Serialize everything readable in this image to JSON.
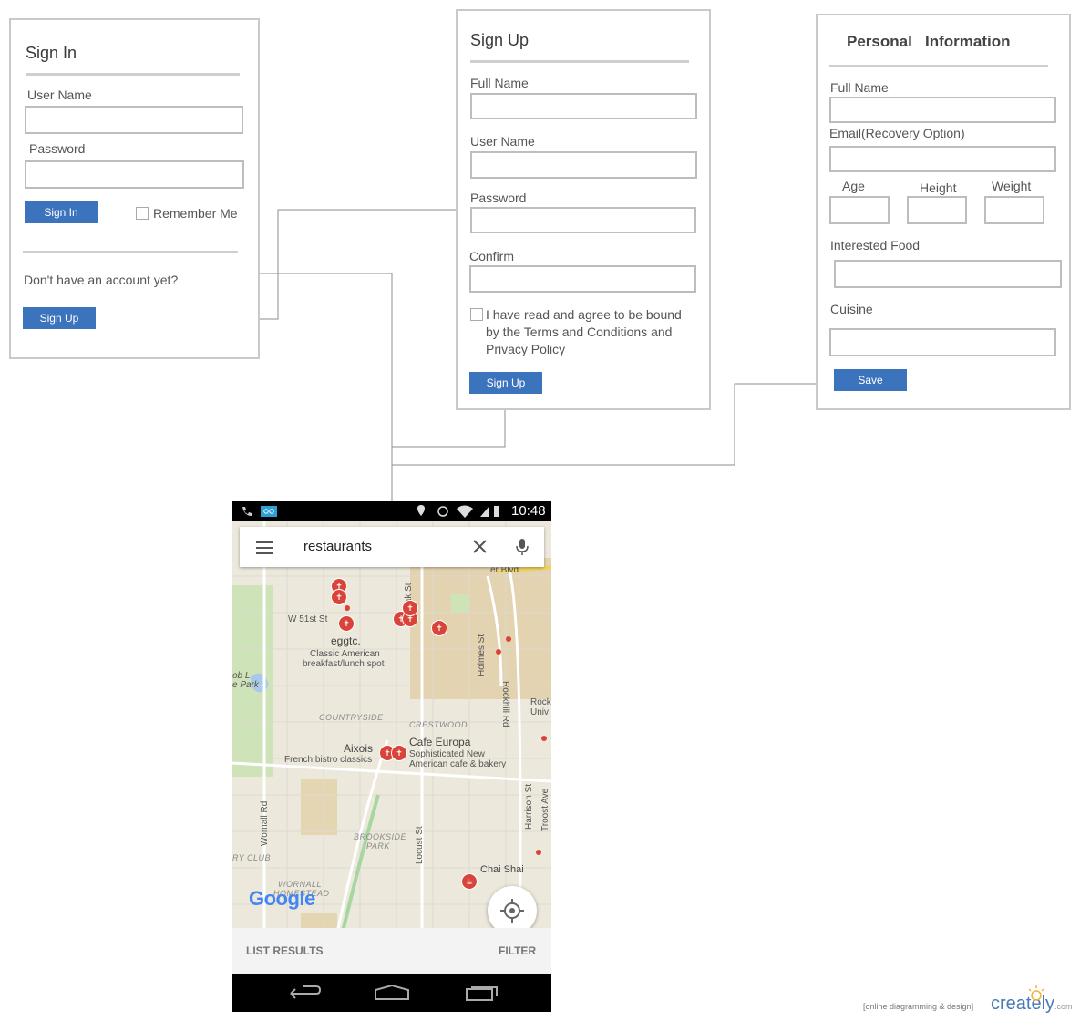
{
  "signin": {
    "title": "Sign In",
    "username_label": "User Name",
    "password_label": "Password",
    "signin_button": "Sign In",
    "remember_label": "Remember Me",
    "no_account_text": "Don't have an account yet?",
    "signup_button": "Sign Up"
  },
  "signup": {
    "title": "Sign Up",
    "fullname_label": "Full Name",
    "username_label": "User Name",
    "password_label": "Password",
    "confirm_label": "Confirm",
    "terms_line1": "I have read and agree to be bound",
    "terms_line2": "by the Terms and Conditions and",
    "terms_line3": "Privacy Policy",
    "signup_button": "Sign Up"
  },
  "personal": {
    "title": "Personal   Information",
    "fullname_label": "Full Name",
    "email_label": "Email(Recovery Option)",
    "age_label": "Age",
    "height_label": "Height",
    "weight_label": "Weight",
    "food_label": "Interested Food",
    "cuisine_label": "Cuisine",
    "save_button": "Save"
  },
  "phone": {
    "time": "10:48",
    "search_value": "restaurants",
    "list_results": "LIST RESULTS",
    "filter": "FILTER",
    "map_labels": {
      "blvd": "er Blvd",
      "oak": "Oak St",
      "w51": "W 51st St",
      "eggtc": "eggtc.",
      "eggtc_desc1": "Classic American",
      "eggtc_desc2": "breakfast/lunch spot",
      "holmes": "Holmes St",
      "rockhill": "Rockhill Rd",
      "lake1": "ob L",
      "lake2": "e Park",
      "rock1": "Rock",
      "rock2": "Univ",
      "countryside": "COUNTRYSIDE",
      "crestwood": "CRESTWOOD",
      "cafe": "Cafe Europa",
      "cafe_desc1": "Sophisticated New",
      "cafe_desc2": "American cafe & bakery",
      "aixois": "Aixois",
      "aixois_desc": "French bistro classics",
      "wornall_rd": "Wornall Rd",
      "harrison": "Harrison St",
      "troost": "Troost Ave",
      "brookside1": "BROOKSIDE",
      "brookside2": "PARK",
      "locust": "Locust St",
      "club": "RY CLUB",
      "wornall1": "WORNALL",
      "wornall2": "HOMESTEAD",
      "chai": "Chai Shai",
      "google": "Google"
    }
  },
  "footer": {
    "tagline": "[online diagramming & design]",
    "brand": "creately",
    "brand_suffix": ".com"
  },
  "colors": {
    "button": "#3c73bd",
    "connector": "#8a8a8a",
    "panel_border": "#c9c9c9",
    "pin": "#d9443a"
  }
}
